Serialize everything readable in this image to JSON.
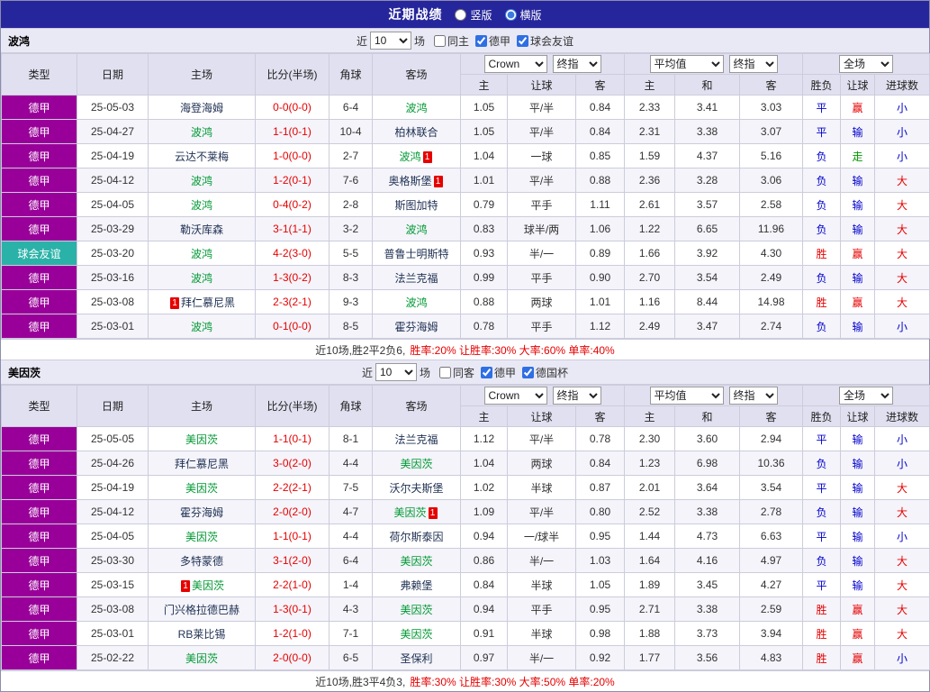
{
  "colors": {
    "topbar_bg": "#26269c",
    "section_bg": "#e9e9f6",
    "header_bg": "#e0e0f0",
    "row_alt": "#f4f4fa",
    "grid": "#ccccdd",
    "league_bg": "#990099",
    "friendly_bg": "#2bb2a8",
    "red": "#e60000",
    "blue": "#0000cc",
    "green": "#009900",
    "focal_team": "#009933",
    "team": "#223355",
    "score": "#e60000"
  },
  "topbar": {
    "title": "近期战绩",
    "radios": [
      {
        "label": "竖版",
        "selected": false
      },
      {
        "label": "横版",
        "selected": true
      }
    ]
  },
  "table": {
    "cols": [
      "类型",
      "日期",
      "主场",
      "比分(半场)",
      "角球",
      "客场"
    ],
    "sub": [
      "主",
      "让球",
      "客",
      "主",
      "和",
      "客",
      "胜负",
      "让球",
      "进球数"
    ],
    "dropdowns": {
      "source": "Crown",
      "source_time": "终指",
      "avg": "平均值",
      "avg_time": "终指",
      "scope": "全场"
    }
  },
  "sections": [
    {
      "team": "波鸿",
      "filter": {
        "prefix": "近",
        "count": "10",
        "suffix": "场",
        "checkboxes": [
          {
            "label": "同主",
            "checked": false
          },
          {
            "label": "德甲",
            "checked": true
          },
          {
            "label": "球会友谊",
            "checked": true
          }
        ]
      },
      "rows": [
        {
          "type": "德甲",
          "type_key": "league",
          "date": "25-05-03",
          "home": {
            "name": "海登海姆"
          },
          "score": "0-0(0-0)",
          "corner": "6-4",
          "away": {
            "name": "波鸿",
            "focal": true
          },
          "odds": [
            "1.05",
            "平/半",
            "0.84"
          ],
          "avg": [
            "2.33",
            "3.41",
            "3.03"
          ],
          "results": [
            [
              "平",
              "blue"
            ],
            [
              "赢",
              "red"
            ],
            [
              "小",
              "blue"
            ]
          ]
        },
        {
          "type": "德甲",
          "type_key": "league",
          "date": "25-04-27",
          "home": {
            "name": "波鸿",
            "focal": true
          },
          "score": "1-1(0-1)",
          "corner": "10-4",
          "away": {
            "name": "柏林联合"
          },
          "odds": [
            "1.05",
            "平/半",
            "0.84"
          ],
          "avg": [
            "2.31",
            "3.38",
            "3.07"
          ],
          "results": [
            [
              "平",
              "blue"
            ],
            [
              "输",
              "blue"
            ],
            [
              "小",
              "blue"
            ]
          ]
        },
        {
          "type": "德甲",
          "type_key": "league",
          "date": "25-04-19",
          "home": {
            "name": "云达不莱梅"
          },
          "score": "1-0(0-0)",
          "corner": "2-7",
          "away": {
            "name": "波鸿",
            "focal": true,
            "card": {
              "pos": "after",
              "text": "1"
            }
          },
          "odds": [
            "1.04",
            "一球",
            "0.85"
          ],
          "avg": [
            "1.59",
            "4.37",
            "5.16"
          ],
          "results": [
            [
              "负",
              "blue"
            ],
            [
              "走",
              "green"
            ],
            [
              "小",
              "blue"
            ]
          ]
        },
        {
          "type": "德甲",
          "type_key": "league",
          "date": "25-04-12",
          "home": {
            "name": "波鸿",
            "focal": true
          },
          "score": "1-2(0-1)",
          "corner": "7-6",
          "away": {
            "name": "奥格斯堡",
            "card": {
              "pos": "after",
              "text": "1"
            }
          },
          "odds": [
            "1.01",
            "平/半",
            "0.88"
          ],
          "avg": [
            "2.36",
            "3.28",
            "3.06"
          ],
          "results": [
            [
              "负",
              "blue"
            ],
            [
              "输",
              "blue"
            ],
            [
              "大",
              "red"
            ]
          ]
        },
        {
          "type": "德甲",
          "type_key": "league",
          "date": "25-04-05",
          "home": {
            "name": "波鸿",
            "focal": true
          },
          "score": "0-4(0-2)",
          "corner": "2-8",
          "away": {
            "name": "斯图加特"
          },
          "odds": [
            "0.79",
            "平手",
            "1.11"
          ],
          "avg": [
            "2.61",
            "3.57",
            "2.58"
          ],
          "results": [
            [
              "负",
              "blue"
            ],
            [
              "输",
              "blue"
            ],
            [
              "大",
              "red"
            ]
          ]
        },
        {
          "type": "德甲",
          "type_key": "league",
          "date": "25-03-29",
          "home": {
            "name": "勒沃库森"
          },
          "score": "3-1(1-1)",
          "corner": "3-2",
          "away": {
            "name": "波鸿",
            "focal": true
          },
          "odds": [
            "0.83",
            "球半/两",
            "1.06"
          ],
          "avg": [
            "1.22",
            "6.65",
            "11.96"
          ],
          "results": [
            [
              "负",
              "blue"
            ],
            [
              "输",
              "blue"
            ],
            [
              "大",
              "red"
            ]
          ]
        },
        {
          "type": "球会友谊",
          "type_key": "friendly",
          "date": "25-03-20",
          "home": {
            "name": "波鸿",
            "focal": true
          },
          "score": "4-2(3-0)",
          "corner": "5-5",
          "away": {
            "name": "普鲁士明斯特"
          },
          "odds": [
            "0.93",
            "半/一",
            "0.89"
          ],
          "avg": [
            "1.66",
            "3.92",
            "4.30"
          ],
          "results": [
            [
              "胜",
              "red"
            ],
            [
              "赢",
              "red"
            ],
            [
              "大",
              "red"
            ]
          ]
        },
        {
          "type": "德甲",
          "type_key": "league",
          "date": "25-03-16",
          "home": {
            "name": "波鸿",
            "focal": true
          },
          "score": "1-3(0-2)",
          "corner": "8-3",
          "away": {
            "name": "法兰克福"
          },
          "odds": [
            "0.99",
            "平手",
            "0.90"
          ],
          "avg": [
            "2.70",
            "3.54",
            "2.49"
          ],
          "results": [
            [
              "负",
              "blue"
            ],
            [
              "输",
              "blue"
            ],
            [
              "大",
              "red"
            ]
          ]
        },
        {
          "type": "德甲",
          "type_key": "league",
          "date": "25-03-08",
          "home": {
            "name": "拜仁慕尼黑",
            "card": {
              "pos": "before",
              "text": "1"
            }
          },
          "score": "2-3(2-1)",
          "corner": "9-3",
          "away": {
            "name": "波鸿",
            "focal": true
          },
          "odds": [
            "0.88",
            "两球",
            "1.01"
          ],
          "avg": [
            "1.16",
            "8.44",
            "14.98"
          ],
          "results": [
            [
              "胜",
              "red"
            ],
            [
              "赢",
              "red"
            ],
            [
              "大",
              "red"
            ]
          ]
        },
        {
          "type": "德甲",
          "type_key": "league",
          "date": "25-03-01",
          "home": {
            "name": "波鸿",
            "focal": true
          },
          "score": "0-1(0-0)",
          "corner": "8-5",
          "away": {
            "name": "霍芬海姆"
          },
          "odds": [
            "0.78",
            "平手",
            "1.12"
          ],
          "avg": [
            "2.49",
            "3.47",
            "2.74"
          ],
          "results": [
            [
              "负",
              "blue"
            ],
            [
              "输",
              "blue"
            ],
            [
              "小",
              "blue"
            ]
          ]
        }
      ],
      "summary": {
        "record": "近10场,胜2平2负6,",
        "stats": "胜率:20% 让胜率:30% 大率:60% 单率:40%"
      }
    },
    {
      "team": "美因茨",
      "filter": {
        "prefix": "近",
        "count": "10",
        "suffix": "场",
        "checkboxes": [
          {
            "label": "同客",
            "checked": false
          },
          {
            "label": "德甲",
            "checked": true
          },
          {
            "label": "德国杯",
            "checked": true
          }
        ]
      },
      "rows": [
        {
          "type": "德甲",
          "type_key": "league",
          "date": "25-05-05",
          "home": {
            "name": "美因茨",
            "focal": true
          },
          "score": "1-1(0-1)",
          "corner": "8-1",
          "away": {
            "name": "法兰克福"
          },
          "odds": [
            "1.12",
            "平/半",
            "0.78"
          ],
          "avg": [
            "2.30",
            "3.60",
            "2.94"
          ],
          "results": [
            [
              "平",
              "blue"
            ],
            [
              "输",
              "blue"
            ],
            [
              "小",
              "blue"
            ]
          ]
        },
        {
          "type": "德甲",
          "type_key": "league",
          "date": "25-04-26",
          "home": {
            "name": "拜仁慕尼黑"
          },
          "score": "3-0(2-0)",
          "corner": "4-4",
          "away": {
            "name": "美因茨",
            "focal": true
          },
          "odds": [
            "1.04",
            "两球",
            "0.84"
          ],
          "avg": [
            "1.23",
            "6.98",
            "10.36"
          ],
          "results": [
            [
              "负",
              "blue"
            ],
            [
              "输",
              "blue"
            ],
            [
              "小",
              "blue"
            ]
          ]
        },
        {
          "type": "德甲",
          "type_key": "league",
          "date": "25-04-19",
          "home": {
            "name": "美因茨",
            "focal": true
          },
          "score": "2-2(2-1)",
          "corner": "7-5",
          "away": {
            "name": "沃尔夫斯堡"
          },
          "odds": [
            "1.02",
            "半球",
            "0.87"
          ],
          "avg": [
            "2.01",
            "3.64",
            "3.54"
          ],
          "results": [
            [
              "平",
              "blue"
            ],
            [
              "输",
              "blue"
            ],
            [
              "大",
              "red"
            ]
          ]
        },
        {
          "type": "德甲",
          "type_key": "league",
          "date": "25-04-12",
          "home": {
            "name": "霍芬海姆"
          },
          "score": "2-0(2-0)",
          "corner": "4-7",
          "away": {
            "name": "美因茨",
            "focal": true,
            "card": {
              "pos": "after",
              "text": "1"
            }
          },
          "odds": [
            "1.09",
            "平/半",
            "0.80"
          ],
          "avg": [
            "2.52",
            "3.38",
            "2.78"
          ],
          "results": [
            [
              "负",
              "blue"
            ],
            [
              "输",
              "blue"
            ],
            [
              "大",
              "red"
            ]
          ]
        },
        {
          "type": "德甲",
          "type_key": "league",
          "date": "25-04-05",
          "home": {
            "name": "美因茨",
            "focal": true
          },
          "score": "1-1(0-1)",
          "corner": "4-4",
          "away": {
            "name": "荷尔斯泰因"
          },
          "odds": [
            "0.94",
            "一/球半",
            "0.95"
          ],
          "avg": [
            "1.44",
            "4.73",
            "6.63"
          ],
          "results": [
            [
              "平",
              "blue"
            ],
            [
              "输",
              "blue"
            ],
            [
              "小",
              "blue"
            ]
          ]
        },
        {
          "type": "德甲",
          "type_key": "league",
          "date": "25-03-30",
          "home": {
            "name": "多特蒙德"
          },
          "score": "3-1(2-0)",
          "corner": "6-4",
          "away": {
            "name": "美因茨",
            "focal": true
          },
          "odds": [
            "0.86",
            "半/一",
            "1.03"
          ],
          "avg": [
            "1.64",
            "4.16",
            "4.97"
          ],
          "results": [
            [
              "负",
              "blue"
            ],
            [
              "输",
              "blue"
            ],
            [
              "大",
              "red"
            ]
          ]
        },
        {
          "type": "德甲",
          "type_key": "league",
          "date": "25-03-15",
          "home": {
            "name": "美因茨",
            "focal": true,
            "card": {
              "pos": "before",
              "text": "1"
            }
          },
          "score": "2-2(1-0)",
          "corner": "1-4",
          "away": {
            "name": "弗赖堡"
          },
          "odds": [
            "0.84",
            "半球",
            "1.05"
          ],
          "avg": [
            "1.89",
            "3.45",
            "4.27"
          ],
          "results": [
            [
              "平",
              "blue"
            ],
            [
              "输",
              "blue"
            ],
            [
              "大",
              "red"
            ]
          ]
        },
        {
          "type": "德甲",
          "type_key": "league",
          "date": "25-03-08",
          "home": {
            "name": "门兴格拉德巴赫"
          },
          "score": "1-3(0-1)",
          "corner": "4-3",
          "away": {
            "name": "美因茨",
            "focal": true
          },
          "odds": [
            "0.94",
            "平手",
            "0.95"
          ],
          "avg": [
            "2.71",
            "3.38",
            "2.59"
          ],
          "results": [
            [
              "胜",
              "red"
            ],
            [
              "赢",
              "red"
            ],
            [
              "大",
              "red"
            ]
          ]
        },
        {
          "type": "德甲",
          "type_key": "league",
          "date": "25-03-01",
          "home": {
            "name": "RB莱比锡"
          },
          "score": "1-2(1-0)",
          "corner": "7-1",
          "away": {
            "name": "美因茨",
            "focal": true
          },
          "odds": [
            "0.91",
            "半球",
            "0.98"
          ],
          "avg": [
            "1.88",
            "3.73",
            "3.94"
          ],
          "results": [
            [
              "胜",
              "red"
            ],
            [
              "赢",
              "red"
            ],
            [
              "大",
              "red"
            ]
          ]
        },
        {
          "type": "德甲",
          "type_key": "league",
          "date": "25-02-22",
          "home": {
            "name": "美因茨",
            "focal": true
          },
          "score": "2-0(0-0)",
          "corner": "6-5",
          "away": {
            "name": "圣保利"
          },
          "odds": [
            "0.97",
            "半/一",
            "0.92"
          ],
          "avg": [
            "1.77",
            "3.56",
            "4.83"
          ],
          "results": [
            [
              "胜",
              "red"
            ],
            [
              "赢",
              "red"
            ],
            [
              "小",
              "blue"
            ]
          ]
        }
      ],
      "summary": {
        "record": "近10场,胜3平4负3,",
        "stats": "胜率:30% 让胜率:30% 大率:50% 单率:20%"
      }
    }
  ]
}
